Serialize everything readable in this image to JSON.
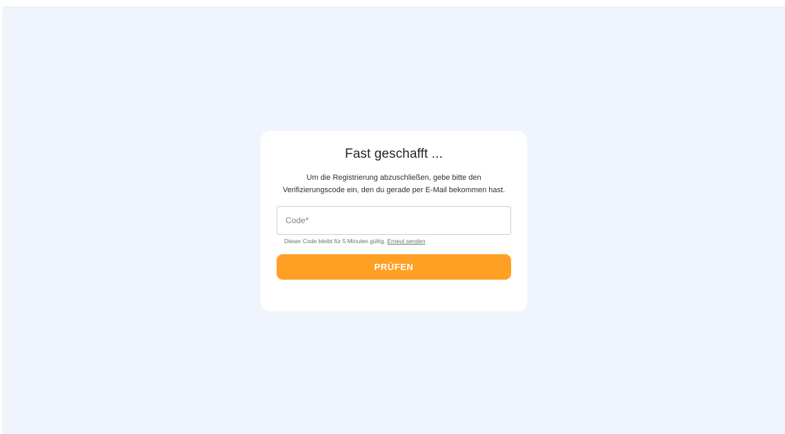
{
  "card": {
    "title": "Fast geschafft ...",
    "description": "Um die Registrierung abzuschließen, gebe bitte den Verifizierungscode ein, den du gerade per E-Mail bekommen hast.",
    "code_field": {
      "placeholder": "Code*",
      "value": ""
    },
    "helper_text": "Dieser Code bleibt für 5 Minuten gültig. ",
    "resend_link": "Erneut senden",
    "submit_label": "PRÜFEN"
  },
  "colors": {
    "background": "#f0f4fd",
    "card": "#ffffff",
    "accent": "#ffa024"
  }
}
